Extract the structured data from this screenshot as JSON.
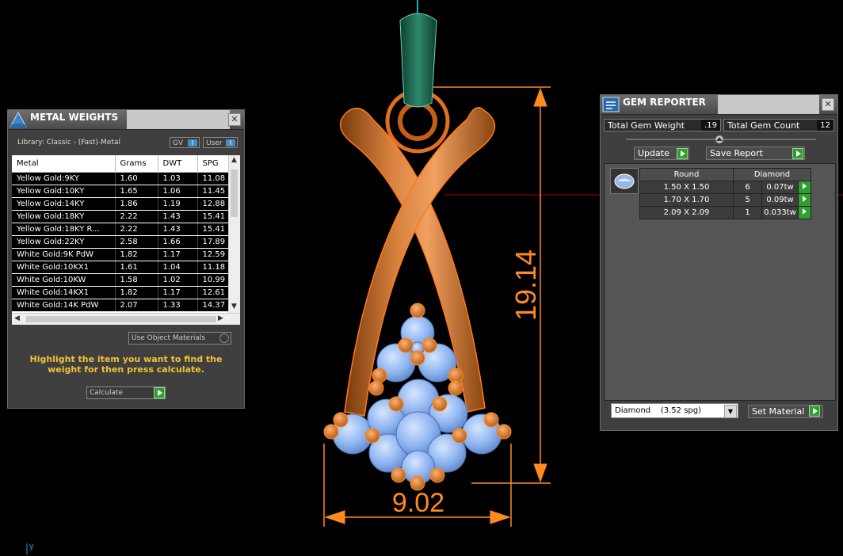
{
  "viewport": {
    "dimension_height": "19.14",
    "dimension_width": "9.02",
    "axis_label": "y"
  },
  "metal_weights": {
    "title": "METAL WEIGHTS",
    "close": "✕",
    "library": "Library: Classic - (Fast)-Metal",
    "gv_label": "GV",
    "user_label": "User",
    "columns": [
      "Metal",
      "Grams",
      "DWT",
      "SPG"
    ],
    "rows": [
      [
        "Yellow Gold:9KY",
        "1.60",
        "1.03",
        "11.08"
      ],
      [
        "Yellow Gold:10KY",
        "1.65",
        "1.06",
        "11.45"
      ],
      [
        "Yellow Gold:14KY",
        "1.86",
        "1.19",
        "12.88"
      ],
      [
        "Yellow Gold:18KY",
        "2.22",
        "1.43",
        "15.41"
      ],
      [
        "Yellow Gold:18KY R...",
        "2.22",
        "1.43",
        "15.41"
      ],
      [
        "Yellow Gold:22KY",
        "2.58",
        "1.66",
        "17.89"
      ],
      [
        "White Gold:9K PdW",
        "1.82",
        "1.17",
        "12.59"
      ],
      [
        "White Gold:10KX1",
        "1.61",
        "1.04",
        "11.18"
      ],
      [
        "White Gold:10KW",
        "1.58",
        "1.02",
        "10.99"
      ],
      [
        "White Gold:14KX1",
        "1.82",
        "1.17",
        "12.61"
      ],
      [
        "White Gold:14K PdW",
        "2.07",
        "1.33",
        "14.37"
      ]
    ],
    "use_object_materials": "Use Object Materials",
    "hint": "Highlight the item you want to find the weight for then press calculate.",
    "calculate": "Calculate"
  },
  "gem_reporter": {
    "title": "GEM REPORTER",
    "close": "✕",
    "total_gem_weight_label": "Total Gem Weight",
    "total_gem_weight": ".19",
    "total_gem_count_label": "Total Gem Count",
    "total_gem_count": "12",
    "update": "Update",
    "save_report": "Save Report",
    "header_shape": "Round",
    "header_material": "Diamond",
    "rows": [
      [
        "1.50 X 1.50",
        "6",
        "0.07tw"
      ],
      [
        "1.70 X 1.70",
        "5",
        "0.09tw"
      ],
      [
        "2.09 X 2.09",
        "1",
        "0.033tw"
      ]
    ],
    "material_select": "Diamond    (3.52 spg)",
    "set_material": "Set Material"
  }
}
